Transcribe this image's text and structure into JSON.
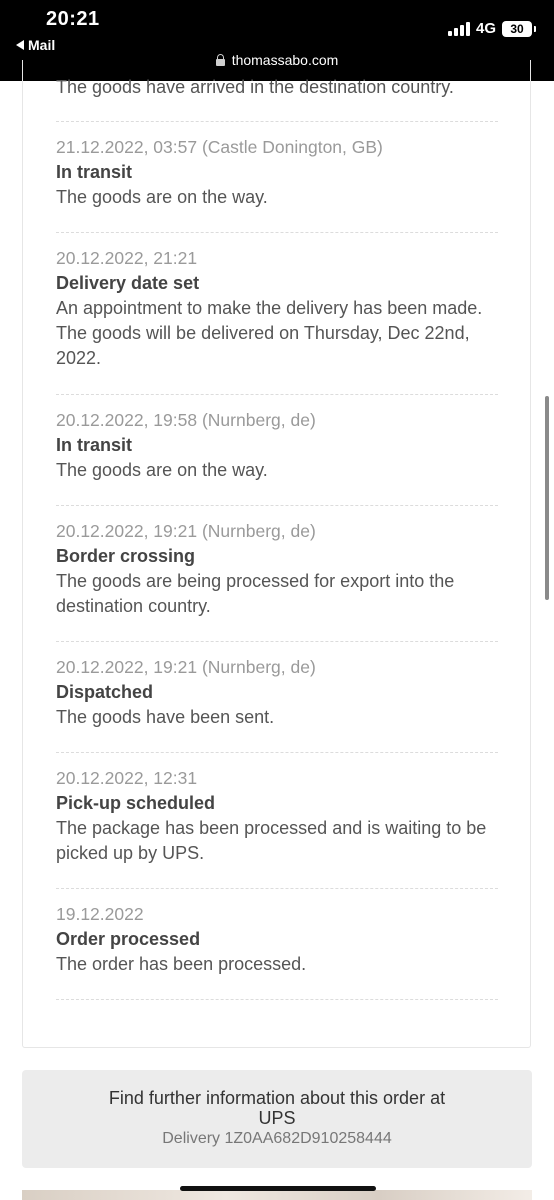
{
  "status_bar": {
    "time": "20:21",
    "back_app": "Mail",
    "network": "4G",
    "battery": "30"
  },
  "browser": {
    "url": "thomassabo.com"
  },
  "tracking": {
    "top_partial_text": "The goods have arrived in the destination country.",
    "events": [
      {
        "meta": "21.12.2022, 03:57 (Castle Donington, GB)",
        "title": "In transit",
        "description": "The goods are on the way."
      },
      {
        "meta": "20.12.2022, 21:21",
        "title": "Delivery date set",
        "description": "An appointment to make the delivery has been made. The goods will be delivered on Thursday, Dec 22nd, 2022."
      },
      {
        "meta": "20.12.2022, 19:58 (Nurnberg, de)",
        "title": "In transit",
        "description": "The goods are on the way."
      },
      {
        "meta": "20.12.2022, 19:21 (Nurnberg, de)",
        "title": "Border crossing",
        "description": "The goods are being processed for export into the destination country."
      },
      {
        "meta": "20.12.2022, 19:21 (Nurnberg, de)",
        "title": "Dispatched",
        "description": "The goods have been sent."
      },
      {
        "meta": "20.12.2022, 12:31",
        "title": "Pick-up scheduled",
        "description": "The package has been processed and is waiting to be picked up by UPS."
      },
      {
        "meta": "19.12.2022",
        "title": "Order processed",
        "description": "The order has been processed."
      }
    ]
  },
  "info_box": {
    "text": "Find further information about this order at UPS",
    "tracking_number": "Delivery 1Z0AA682D910258444"
  }
}
